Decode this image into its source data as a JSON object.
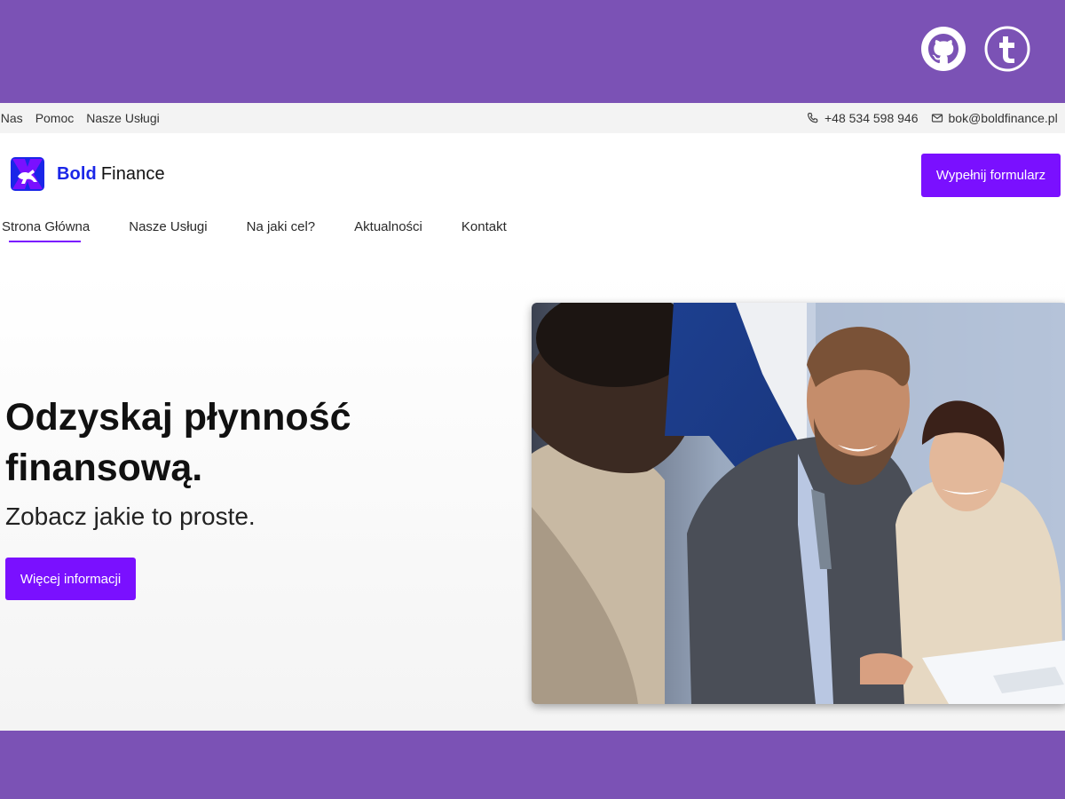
{
  "social": {
    "github_icon": "github-icon",
    "t_icon": "tumblr-t-icon"
  },
  "utility": {
    "links": [
      "O Nas",
      "Pomoc",
      "Nasze Usługi"
    ],
    "phone": "+48 534 598 946",
    "email": "bok@boldfinance.pl"
  },
  "brand": {
    "name_bold": "Bold",
    "name_rest": "Finance"
  },
  "header": {
    "cta_label": "Wypełnij formularz"
  },
  "nav": {
    "items": [
      "Strona Główna",
      "Nasze Usługi",
      "Na jaki cel?",
      "Aktualności",
      "Kontakt"
    ],
    "active": "Strona Główna"
  },
  "hero": {
    "title": "Odzyskaj płynność finansową.",
    "subtitle": "Zobacz jakie to proste.",
    "cta_label": "Więcej informacji"
  },
  "colors": {
    "accent": "#7a10ff",
    "brand_blue": "#1a26e8",
    "frame_purple": "#7b52b5"
  }
}
